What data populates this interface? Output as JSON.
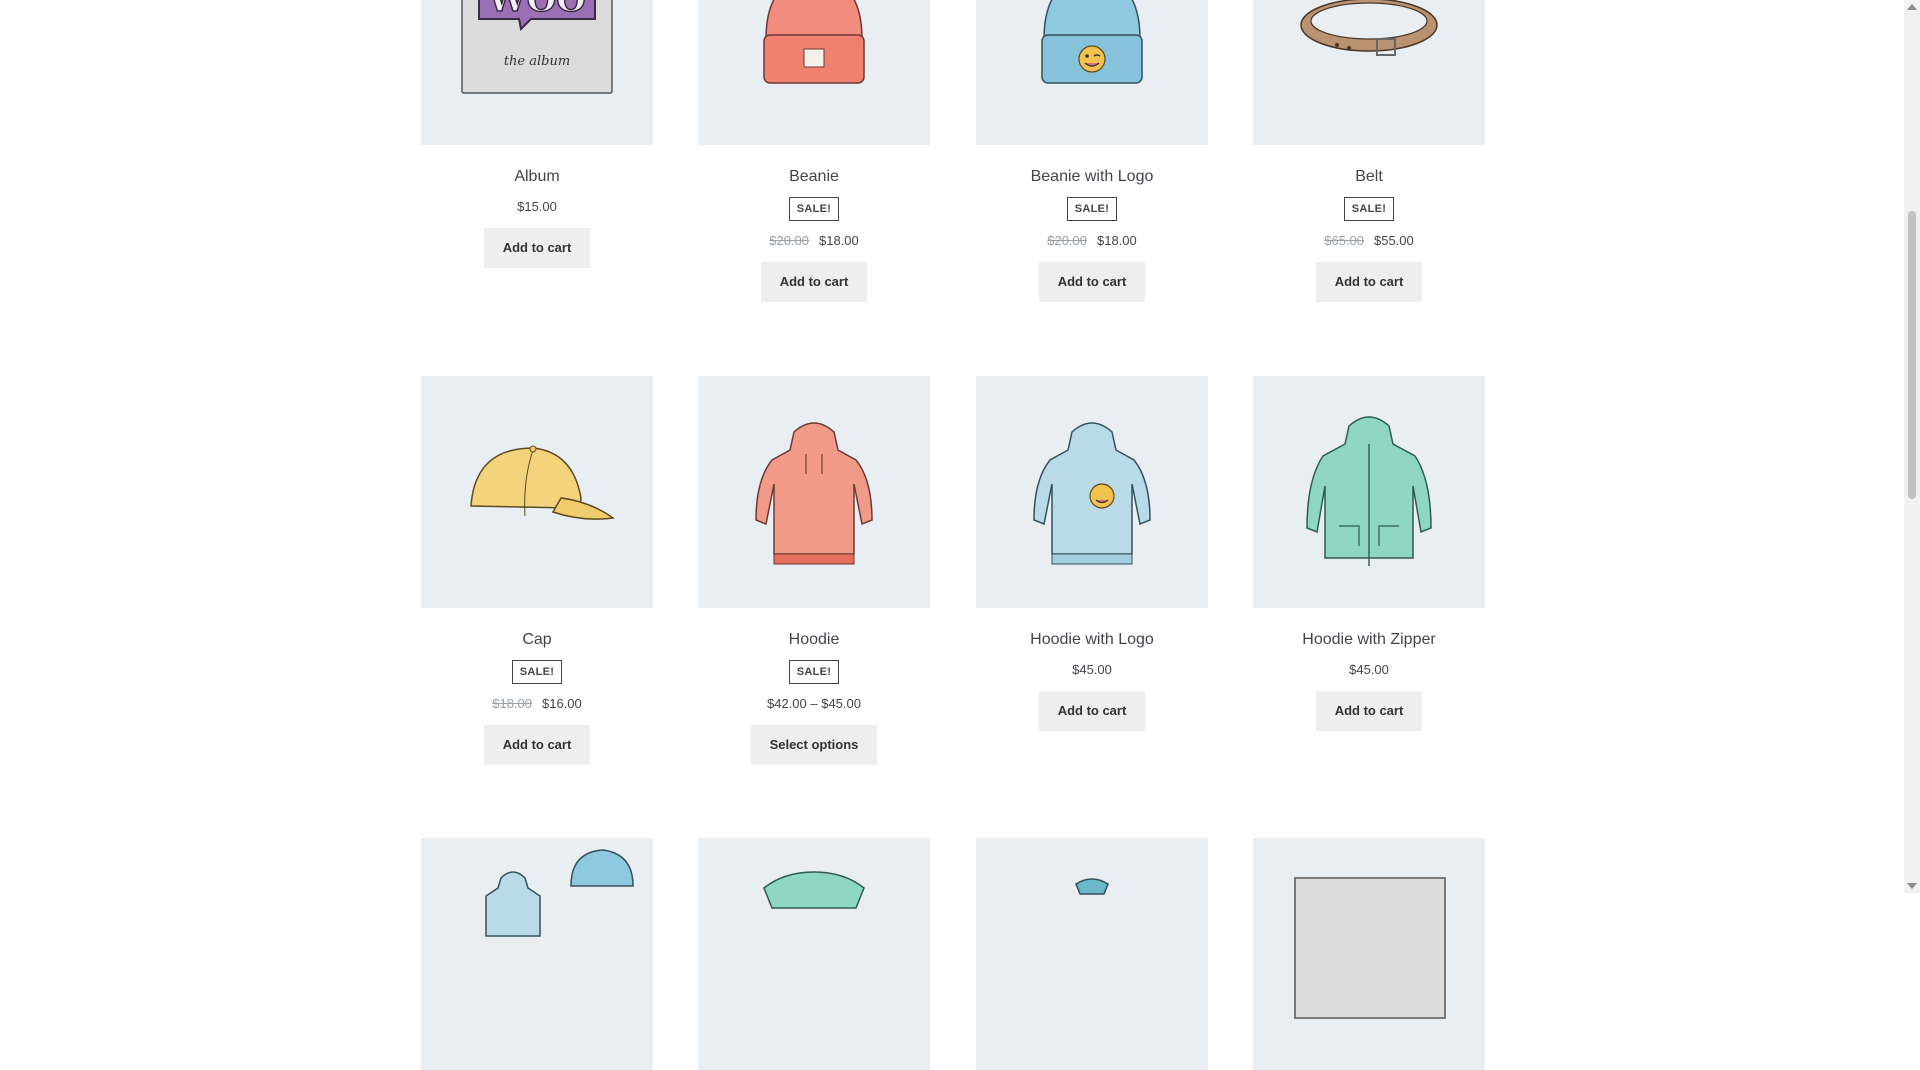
{
  "products": [
    {
      "title": "Album",
      "price": "$15.00",
      "button": "Add to cart"
    },
    {
      "title": "Beanie",
      "badge": "SALE!",
      "old_price": "$20.00",
      "price": "$18.00",
      "button": "Add to cart"
    },
    {
      "title": "Beanie with Logo",
      "badge": "SALE!",
      "old_price": "$20.00",
      "price": "$18.00",
      "button": "Add to cart"
    },
    {
      "title": "Belt",
      "badge": "SALE!",
      "old_price": "$65.00",
      "price": "$55.00",
      "button": "Add to cart"
    },
    {
      "title": "Cap",
      "badge": "SALE!",
      "old_price": "$18.00",
      "price": "$16.00",
      "button": "Add to cart"
    },
    {
      "title": "Hoodie",
      "badge": "SALE!",
      "price": "$42.00 – $45.00",
      "button": "Select options"
    },
    {
      "title": "Hoodie with Logo",
      "price": "$45.00",
      "button": "Add to cart"
    },
    {
      "title": "Hoodie with Zipper",
      "price": "$45.00",
      "button": "Add to cart"
    }
  ],
  "album_art": {
    "brand_text": "WOO",
    "caption_text": "the album"
  },
  "colors": {
    "thumb_bg": "#e9eef2",
    "button_bg": "#eeeeee",
    "text": "#43454b",
    "muted": "#9aa0a6"
  }
}
